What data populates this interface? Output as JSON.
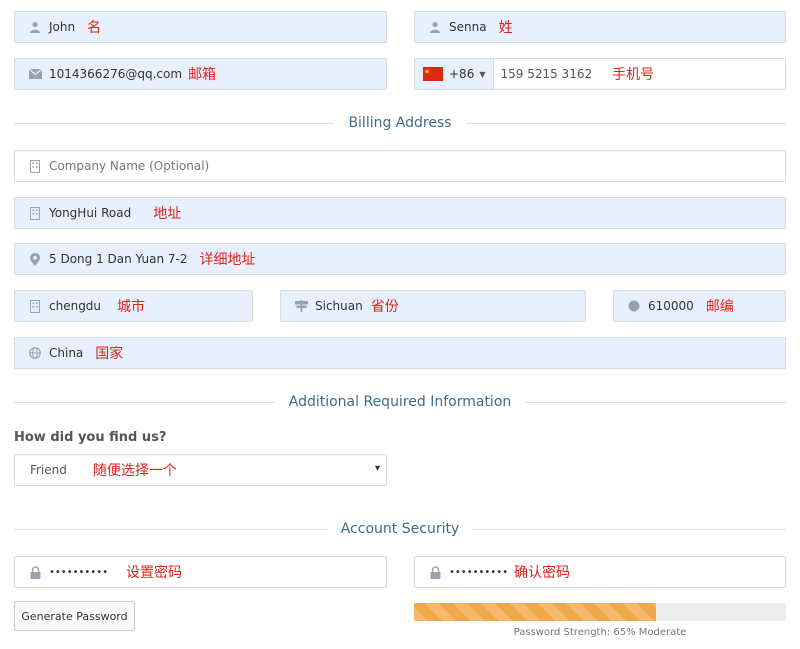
{
  "personal": {
    "first_name": {
      "value": "John",
      "note": "名"
    },
    "last_name": {
      "value": "Senna",
      "note": "姓"
    },
    "email": {
      "value": "1014366276@qq.com",
      "note": "邮箱"
    },
    "phone": {
      "country_code": "+86",
      "value": "159 5215 3162",
      "note": "手机号"
    }
  },
  "billing": {
    "section_title": "Billing Address",
    "company": {
      "placeholder": "Company Name (Optional)"
    },
    "address1": {
      "value": "YongHui Road",
      "note": "地址"
    },
    "address2": {
      "value": "5 Dong 1 Dan Yuan 7-2",
      "note": "详细地址"
    },
    "city": {
      "value": "chengdu",
      "note": "城市"
    },
    "state": {
      "value": "Sichuan",
      "note": "省份"
    },
    "postcode": {
      "value": "610000",
      "note": "邮编"
    },
    "country": {
      "value": "China",
      "note": "国家"
    }
  },
  "additional": {
    "section_title": "Additional Required Information",
    "question": "How did you find us?",
    "select": {
      "value": "Friend",
      "note": "随便选择一个",
      "arrow": "▾"
    }
  },
  "security": {
    "section_title": "Account Security",
    "password": {
      "value": "••••••••••",
      "note": "设置密码"
    },
    "confirm": {
      "value": "••••••••••",
      "note": "确认密码"
    },
    "generate_label": "Generate Password",
    "strength_text": "Password Strength: 65% Moderate",
    "strength_percent": 65
  },
  "colors": {
    "autofill_bg": "#e8f0fe",
    "annotation": "#e2231a",
    "section_title": "#3d6c8f",
    "strength_fill": "#f4b96a"
  },
  "icons": {
    "user": "user-icon",
    "email": "envelope-icon",
    "building": "building-icon",
    "location": "map-pin-icon",
    "sign": "signpost-icon",
    "circle": "circle-icon",
    "globe": "globe-icon",
    "lock": "lock-icon",
    "flag": "china-flag-icon"
  }
}
